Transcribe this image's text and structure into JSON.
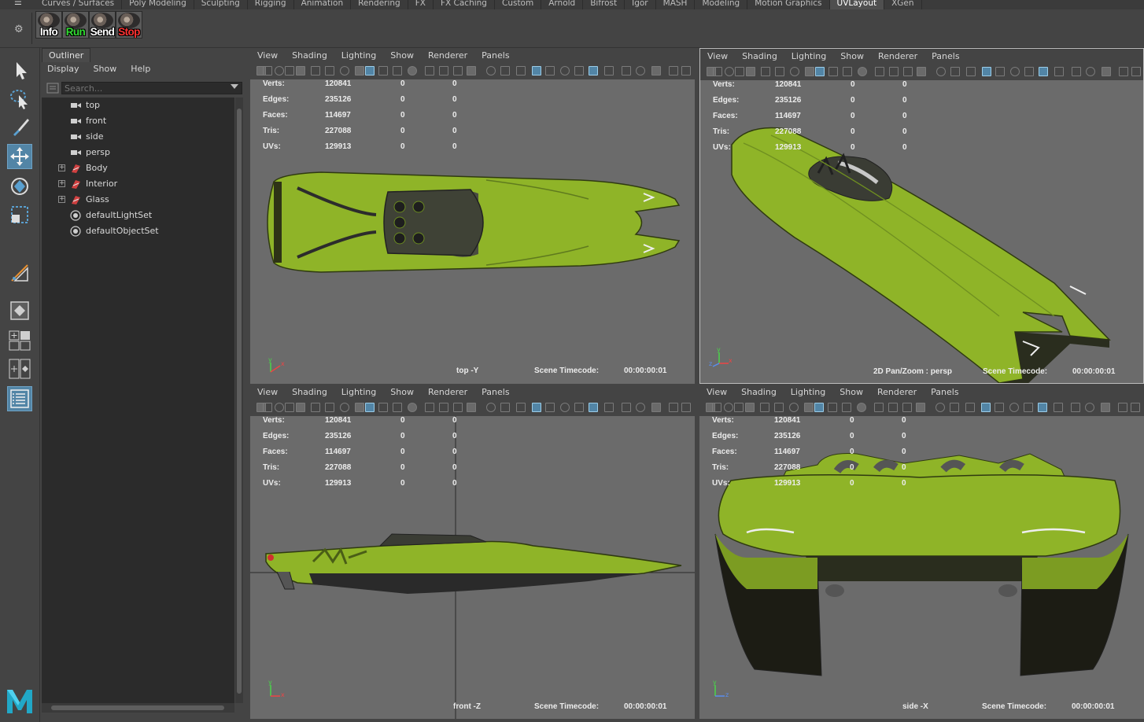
{
  "shelf_tabs": {
    "items": [
      "Curves / Surfaces",
      "Poly Modeling",
      "Sculpting",
      "Rigging",
      "Animation",
      "Rendering",
      "FX",
      "FX Caching",
      "Custom",
      "Arnold",
      "Bifrost",
      "Igor",
      "MASH",
      "Modeling",
      "Motion Graphics",
      "UVLayout",
      "XGen"
    ],
    "active": "UVLayout"
  },
  "shelf": {
    "buttons": [
      {
        "label": "Info",
        "color": "#ffffff"
      },
      {
        "label": "Run",
        "color": "#33dd33"
      },
      {
        "label": "Send",
        "color": "#ffffff"
      },
      {
        "label": "Stop",
        "color": "#ff3333"
      }
    ]
  },
  "outliner": {
    "tab_title": "Outliner",
    "menus": [
      "Display",
      "Show",
      "Help"
    ],
    "search_placeholder": "Search...",
    "items": [
      {
        "label": "top",
        "icon": "camera-icon",
        "expandable": false
      },
      {
        "label": "front",
        "icon": "camera-icon",
        "expandable": false
      },
      {
        "label": "side",
        "icon": "camera-icon",
        "expandable": false
      },
      {
        "label": "persp",
        "icon": "camera-icon",
        "expandable": false
      },
      {
        "label": "Body",
        "icon": "transform-icon",
        "expandable": true
      },
      {
        "label": "Interior",
        "icon": "transform-icon",
        "expandable": true
      },
      {
        "label": "Glass",
        "icon": "transform-icon",
        "expandable": true
      },
      {
        "label": "defaultLightSet",
        "icon": "set-icon",
        "expandable": false
      },
      {
        "label": "defaultObjectSet",
        "icon": "set-icon",
        "expandable": false
      }
    ]
  },
  "panel_menus": [
    "View",
    "Shading",
    "Lighting",
    "Show",
    "Renderer",
    "Panels"
  ],
  "hud": {
    "rows": [
      {
        "key": "Verts:",
        "value": "120841",
        "z1": "0",
        "z2": "0"
      },
      {
        "key": "Edges:",
        "value": "235126",
        "z1": "0",
        "z2": "0"
      },
      {
        "key": "Faces:",
        "value": "114697",
        "z1": "0",
        "z2": "0"
      },
      {
        "key": "Tris:",
        "value": "227088",
        "z1": "0",
        "z2": "0"
      },
      {
        "key": "UVs:",
        "value": "129913",
        "z1": "0",
        "z2": "0"
      }
    ],
    "timecode_label": "Scene Timecode:",
    "timecode": "00:00:00:01"
  },
  "viewports": {
    "top": {
      "camera": "top -Y"
    },
    "persp": {
      "camera": "2D Pan/Zoom : persp"
    },
    "front": {
      "camera": "front -Z"
    },
    "side": {
      "camera": "side -X"
    }
  },
  "colors": {
    "boat_green": "#8fb428",
    "selected_tool": "#5285a6",
    "viewport_bg": "#6b6b6b",
    "maya_logo": "#21a8c7"
  }
}
